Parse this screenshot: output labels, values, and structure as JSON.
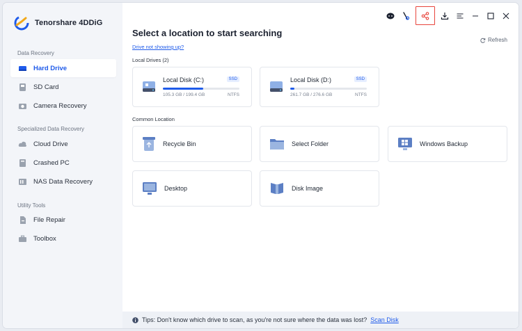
{
  "app": {
    "name": "Tenorshare 4DDiG"
  },
  "colors": {
    "accent": "#1f5bea",
    "highlight": "#e8453c"
  },
  "sidebar": {
    "sections": [
      {
        "title": "Data Recovery",
        "items": [
          {
            "label": "Hard Drive",
            "icon": "hard-drive-icon",
            "active": true
          },
          {
            "label": "SD Card",
            "icon": "sd-card-icon"
          },
          {
            "label": "Camera Recovery",
            "icon": "camera-icon"
          }
        ]
      },
      {
        "title": "Specialized Data Recovery",
        "items": [
          {
            "label": "Cloud Drive",
            "icon": "cloud-icon"
          },
          {
            "label": "Crashed PC",
            "icon": "crashed-pc-icon"
          },
          {
            "label": "NAS Data Recovery",
            "icon": "nas-icon"
          }
        ]
      },
      {
        "title": "Utility Tools",
        "items": [
          {
            "label": "File Repair",
            "icon": "file-repair-icon"
          },
          {
            "label": "Toolbox",
            "icon": "toolbox-icon"
          }
        ]
      }
    ]
  },
  "main": {
    "title": "Select a location to start searching",
    "drive_link": "Drive not showing up?",
    "refresh": "Refresh",
    "local_drives_label": "Local Drives (2)",
    "drives": [
      {
        "name": "Local Disk (C:)",
        "badge": "SSD",
        "usage": "105.3 GB / 199.4 GB",
        "fs": "NTFS",
        "used_fraction": 0.53
      },
      {
        "name": "Local Disk (D:)",
        "badge": "SSD",
        "usage": "261.7 GB / 276.6 GB",
        "fs": "NTFS",
        "used_fraction": 0.05
      }
    ],
    "common_label": "Common Location",
    "locations": [
      {
        "label": "Recycle Bin",
        "icon": "recycle-bin-icon"
      },
      {
        "label": "Select Folder",
        "icon": "folder-icon"
      },
      {
        "label": "Windows Backup",
        "icon": "windows-backup-icon"
      },
      {
        "label": "Desktop",
        "icon": "desktop-icon"
      },
      {
        "label": "Disk Image",
        "icon": "disk-image-icon"
      }
    ],
    "tips": {
      "text": "Tips: Don't know which drive to scan, as you're not sure where the data was lost?",
      "link": "Scan Disk"
    }
  }
}
